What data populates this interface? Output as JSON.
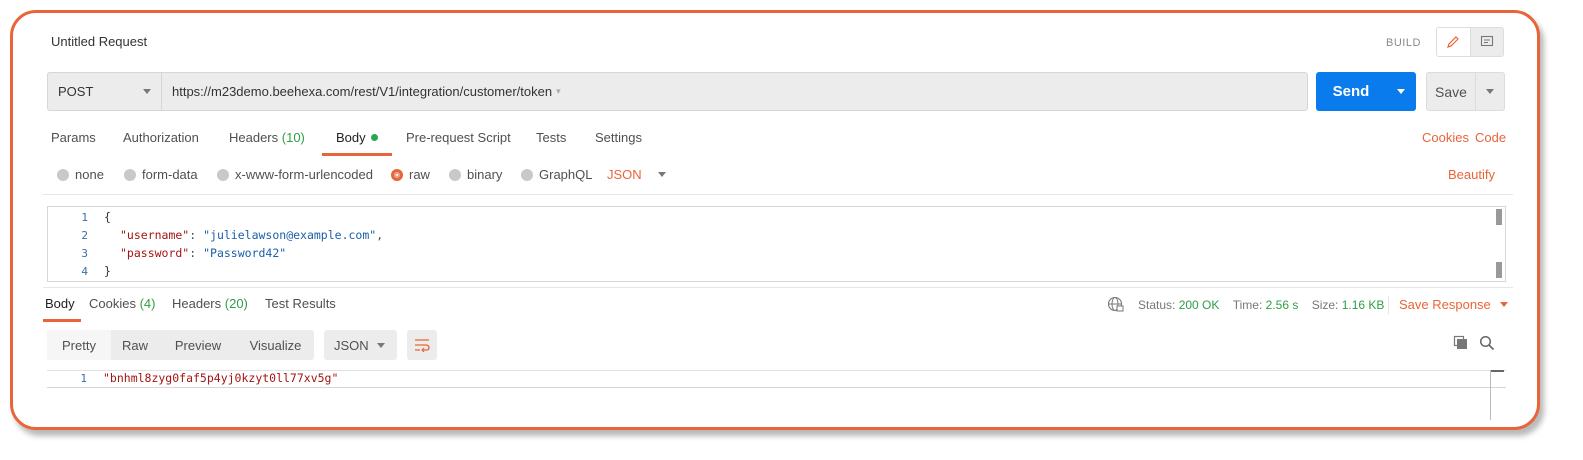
{
  "request": {
    "title": "Untitled Request",
    "build_label": "BUILD",
    "method": "POST",
    "url": "https://m23demo.beehexa.com/rest/V1/integration/customer/token",
    "send_label": "Send",
    "save_label": "Save"
  },
  "request_tabs": [
    {
      "label": "Params",
      "count": ""
    },
    {
      "label": "Authorization",
      "count": ""
    },
    {
      "label": "Headers",
      "count": "(10)"
    },
    {
      "label": "Body",
      "count": ""
    },
    {
      "label": "Pre-request Script",
      "count": ""
    },
    {
      "label": "Tests",
      "count": ""
    },
    {
      "label": "Settings",
      "count": ""
    }
  ],
  "active_request_tab": "Body",
  "links": {
    "cookies": "Cookies",
    "code": "Code",
    "beautify": "Beautify"
  },
  "body_types": [
    "none",
    "form-data",
    "x-www-form-urlencoded",
    "raw",
    "binary",
    "GraphQL"
  ],
  "selected_body_type": "raw",
  "body_format": "JSON",
  "request_body": {
    "line_numbers": [
      "1",
      "2",
      "3",
      "4"
    ],
    "open_brace": "{",
    "username_key": "\"username\"",
    "username_value": "\"julielawson@example.com\"",
    "password_key": "\"password\"",
    "password_value": "\"Password42\"",
    "close_brace": "}",
    "colon": ": ",
    "comma": ","
  },
  "response_tabs": [
    {
      "label": "Body",
      "count": ""
    },
    {
      "label": "Cookies",
      "count": "(4)"
    },
    {
      "label": "Headers",
      "count": "(20)"
    },
    {
      "label": "Test Results",
      "count": ""
    }
  ],
  "active_response_tab": "Body",
  "status": {
    "status_label": "Status:",
    "status_value": "200 OK",
    "time_label": "Time:",
    "time_value": "2.56 s",
    "size_label": "Size:",
    "size_value": "1.16 KB",
    "save_response": "Save Response"
  },
  "view_modes": [
    "Pretty",
    "Raw",
    "Preview",
    "Visualize"
  ],
  "active_view_mode": "Pretty",
  "response_format": "JSON",
  "response_body": {
    "line_number": "1",
    "value": "\"bnhml8zyg0faf5p4yj0kzyt0ll77xv5g\""
  },
  "colors": {
    "accent": "#e8653a",
    "send_blue": "#097bed",
    "success": "#2f9e44"
  },
  "icons": [
    "pencil-icon",
    "comment-icon",
    "caret-down-icon",
    "globe-icon",
    "copy-icon",
    "search-icon",
    "wrap-lines-icon"
  ]
}
